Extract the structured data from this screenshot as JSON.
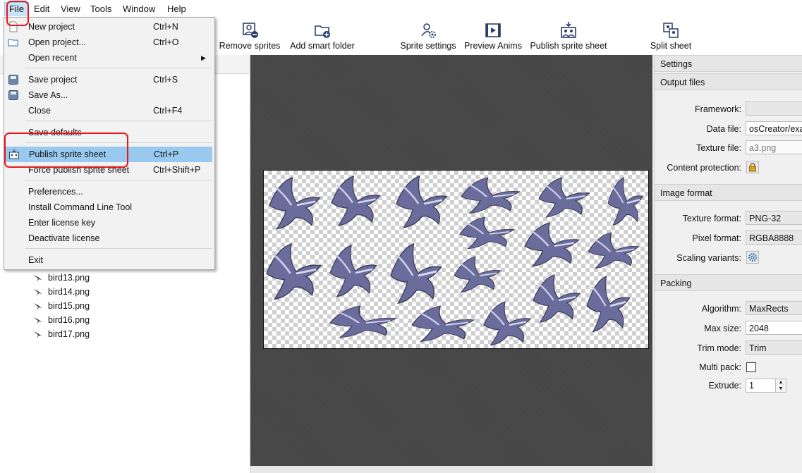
{
  "menubar": {
    "items": [
      {
        "id": "file",
        "label": "File"
      },
      {
        "id": "edit",
        "label": "Edit"
      },
      {
        "id": "view",
        "label": "View"
      },
      {
        "id": "tools",
        "label": "Tools"
      },
      {
        "id": "window",
        "label": "Window"
      },
      {
        "id": "help",
        "label": "Help"
      }
    ]
  },
  "toolbar": {
    "remove_sprites": "Remove sprites",
    "add_smart_folder": "Add smart folder",
    "sprite_settings": "Sprite settings",
    "preview_anims": "Preview Anims",
    "publish_sprite_sheet": "Publish sprite sheet",
    "split_sheet": "Split sheet"
  },
  "file_menu": {
    "new_project": {
      "label": "New project",
      "shortcut": "Ctrl+N"
    },
    "open_project": {
      "label": "Open project...",
      "shortcut": "Ctrl+O"
    },
    "open_recent": {
      "label": "Open recent"
    },
    "save_project": {
      "label": "Save project",
      "shortcut": "Ctrl+S"
    },
    "save_as": {
      "label": "Save As..."
    },
    "close": {
      "label": "Close",
      "shortcut": "Ctrl+F4"
    },
    "save_defaults": {
      "label": "Save defaults"
    },
    "publish_sprite_sheet": {
      "label": "Publish sprite sheet",
      "shortcut": "Ctrl+P"
    },
    "force_publish": {
      "label": "Force publish sprite sheet",
      "shortcut": "Ctrl+Shift+P"
    },
    "preferences": {
      "label": "Preferences..."
    },
    "install_cli": {
      "label": "Install Command Line Tool"
    },
    "enter_license": {
      "label": "Enter license key"
    },
    "deactivate_license": {
      "label": "Deactivate license"
    },
    "exit": {
      "label": "Exit"
    }
  },
  "sprite_list": {
    "items": [
      "bird13.png",
      "bird14.png",
      "bird15.png",
      "bird16.png",
      "bird17.png"
    ]
  },
  "settings": {
    "panel_title": "Settings",
    "output_files": {
      "header": "Output files",
      "framework_label": "Framework:",
      "framework_value": "",
      "data_file_label": "Data file:",
      "data_file_value": "osCreator/exam",
      "texture_file_label": "Texture file:",
      "texture_file_value": "a3.png",
      "content_protection_label": "Content protection:"
    },
    "image_format": {
      "header": "Image format",
      "texture_format_label": "Texture format:",
      "texture_format_value": "PNG-32",
      "pixel_format_label": "Pixel format:",
      "pixel_format_value": "RGBA8888",
      "scaling_variants_label": "Scaling variants:"
    },
    "packing": {
      "header": "Packing",
      "algorithm_label": "Algorithm:",
      "algorithm_value": "MaxRects",
      "max_size_label": "Max size:",
      "max_size_value": "2048",
      "trim_mode_label": "Trim mode:",
      "trim_mode_value": "Trim",
      "multi_pack_label": "Multi pack:",
      "multi_pack_checked": false,
      "extrude_label": "Extrude:",
      "extrude_value": "1"
    }
  },
  "colors": {
    "menu_highlight": "#99c9ef",
    "annotation_red": "#e8161b",
    "canvas_bg": "#474747"
  }
}
